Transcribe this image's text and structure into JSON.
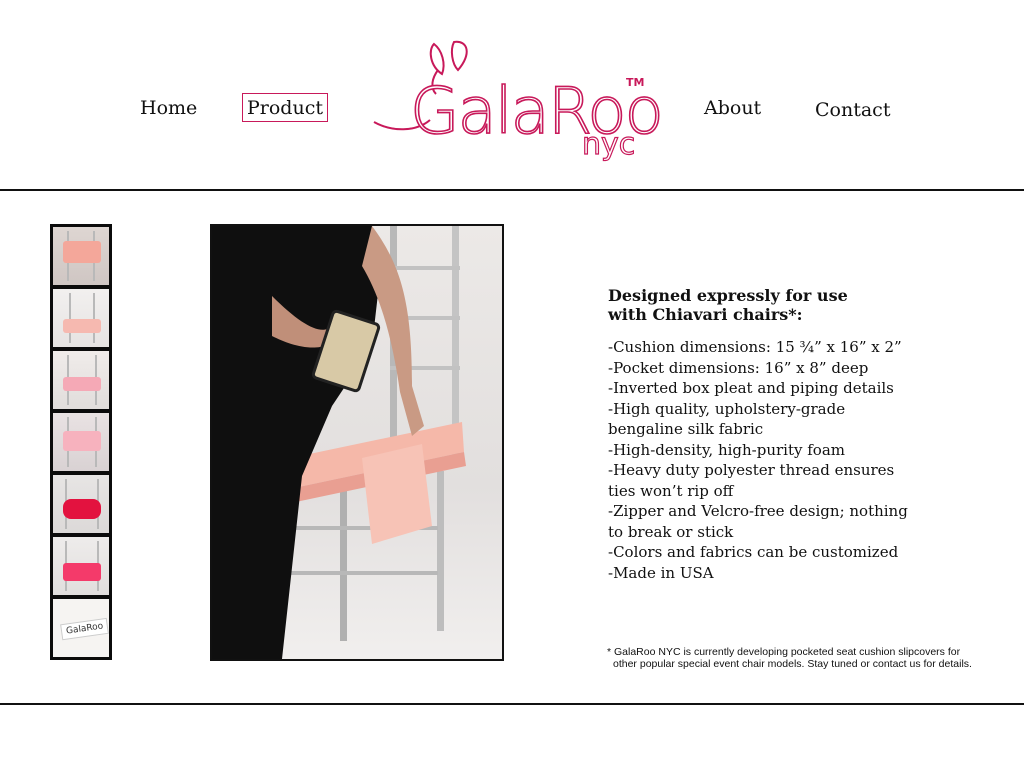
{
  "nav": {
    "home": "Home",
    "product": "Product",
    "about": "About",
    "contact": "Contact"
  },
  "brand": {
    "name": "GalaRoo",
    "suffix": "nyc",
    "trademark": "TM",
    "color": "#c8195a"
  },
  "thumbnails": [
    {
      "id": "thumb-1",
      "label": "GalaRoo"
    },
    {
      "id": "thumb-2"
    },
    {
      "id": "thumb-3"
    },
    {
      "id": "thumb-4"
    },
    {
      "id": "thumb-5"
    },
    {
      "id": "thumb-6"
    },
    {
      "id": "thumb-7"
    }
  ],
  "product": {
    "headline_line1": "Designed expressly for use",
    "headline_line2": "with Chiavari chairs*:",
    "features": [
      "-Cushion dimensions: 15 ¾” x 16” x 2”",
      "-Pocket dimensions: 16” x 8” deep",
      "-Inverted box pleat and piping details",
      "-High quality, upholstery-grade",
      "bengaline silk fabric",
      "-High-density, high-purity foam",
      "-Heavy duty polyester thread ensures",
      "ties won’t rip off",
      "-Zipper and Velcro-free design; nothing",
      "to break or stick",
      "-Colors and fabrics can be customized",
      "-Made in USA"
    ],
    "footnote_line1": "* GalaRoo NYC is currently developing pocketed seat cushion slipcovers for",
    "footnote_line2": "other popular special event chair models. Stay tuned or contact us for details."
  }
}
